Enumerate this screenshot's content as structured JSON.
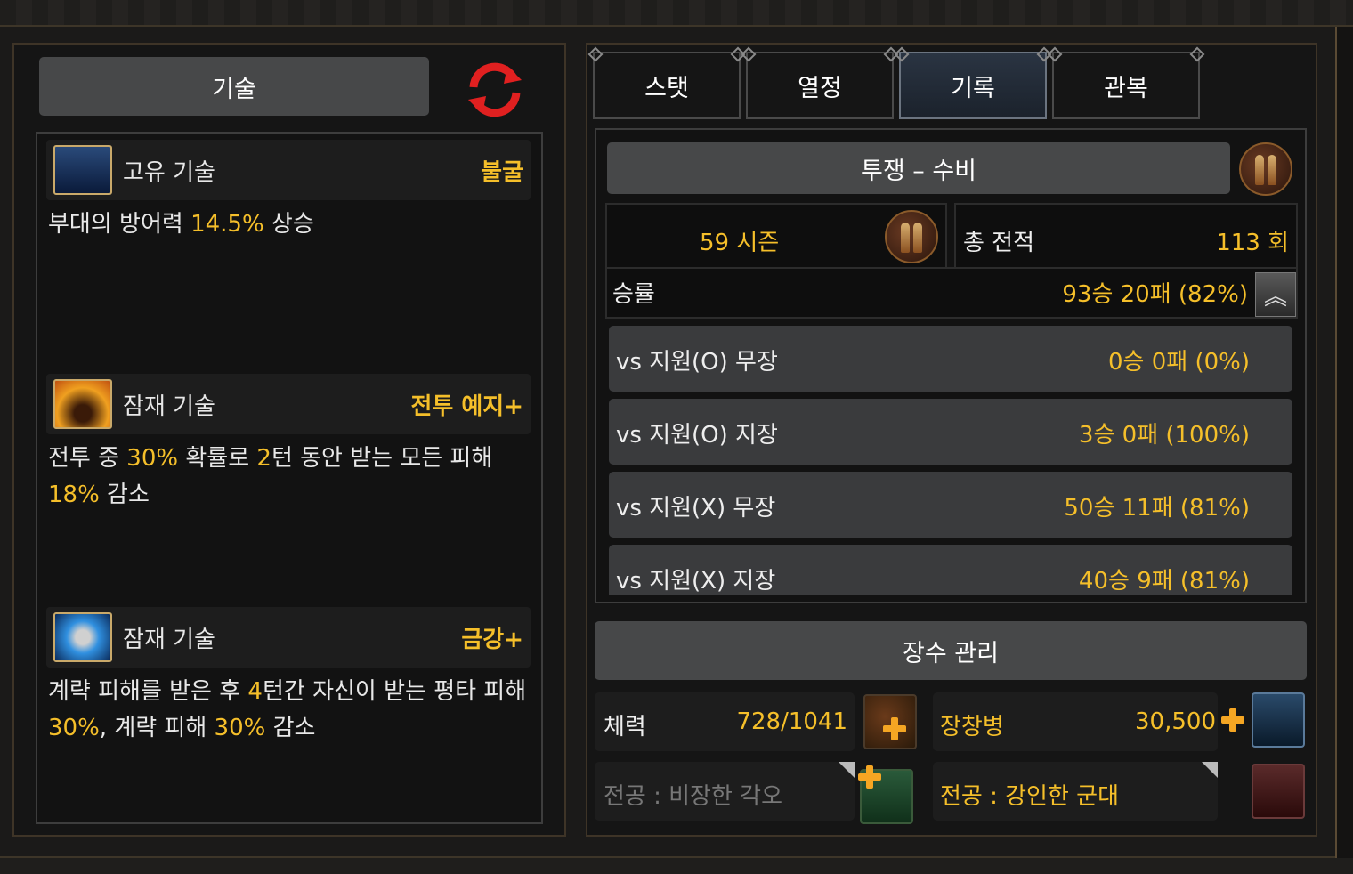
{
  "left": {
    "title_button": "기술",
    "skills": [
      {
        "type": "고유 기술",
        "name": "불굴",
        "desc_parts": [
          "부대의 방어력 ",
          "14.5%",
          " 상승"
        ]
      },
      {
        "type": "잠재 기술",
        "name": "전투 예지+",
        "desc_parts": [
          "전투 중 ",
          "30%",
          " 확률로 ",
          "2",
          "턴 동안 받는 모든 피해 ",
          "18%",
          " 감소"
        ]
      },
      {
        "type": "잠재 기술",
        "name": "금강+",
        "desc_parts": [
          "계략 피해를 받은 후 ",
          "4",
          "턴간 자신이 받는 평타 피해 ",
          "30%",
          ", 계략 피해 ",
          "30%",
          " 감소"
        ]
      }
    ]
  },
  "tabs": [
    "스탯",
    "열정",
    "기록",
    "관복"
  ],
  "active_tab": "기록",
  "record": {
    "mode": "투쟁 – 수비",
    "season": "59 시즌",
    "total_label": "총 전적",
    "total_value": "113 회",
    "winrate_label": "승률",
    "winrate_value": "93승 20패 (82%)",
    "rows": [
      {
        "label": "vs 지원(O) 무장",
        "value": "0승 0패 (0%)"
      },
      {
        "label": "vs 지원(O) 지장",
        "value": "3승 0패 (100%)"
      },
      {
        "label": "vs 지원(X) 무장",
        "value": "50승 11패 (81%)"
      },
      {
        "label": "vs 지원(X) 지장",
        "value": "40승 9패 (81%)"
      }
    ]
  },
  "manage": {
    "title": "장수 관리",
    "hp_label": "체력",
    "hp_value": "728/1041",
    "troop_label": "장창병",
    "troop_value": "30,500",
    "merit_left": "전공 : 비장한 각오",
    "merit_right": "전공 : 강인한 군대"
  },
  "colors": {
    "accent": "#f5bf2a",
    "button": "#474849",
    "panel": "#121212"
  }
}
